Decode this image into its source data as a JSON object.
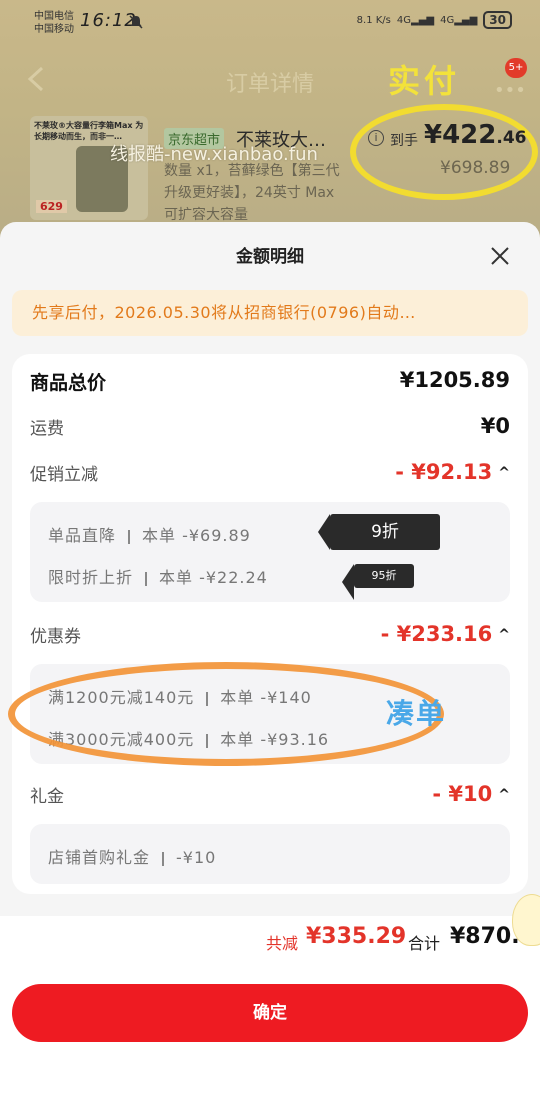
{
  "status_bar": {
    "carrier_1": "中国电信",
    "carrier_2": "中国移动",
    "time": "16:12",
    "speed": "8.1 K/s",
    "network_1": "4G",
    "network_2": "4G",
    "battery": "30"
  },
  "header": {
    "title": "订单详情",
    "annotation_actual_pay": "实付",
    "badge_count": "5+"
  },
  "product": {
    "store_tag": "京东超市",
    "name": "不莱玫大…",
    "desc": "数量 x1，苔藓绿色【第三代升级更好装】，24英寸 Max可扩容大容量",
    "thumb_text": "不莱玫®大容量行李箱Max 为长期移动而生，而非一…",
    "thumb_price": "629",
    "watermark": "线报酷-new.xianbao.fun",
    "pay_label": "到手",
    "pay_amount_int": "¥422",
    "pay_amount_dec": ".46",
    "orig_amount": "¥698.89"
  },
  "sheet": {
    "title": "金额明细",
    "notice": "先享后付，2026.05.30将从招商银行(0796)自动…",
    "total_label": "商品总价",
    "total_value": "¥1205.89",
    "shipping_label": "运费",
    "shipping_value": "¥0",
    "promo_label": "促销立减",
    "promo_value": "- ¥92.13",
    "promo_items": [
      {
        "name": "单品直降",
        "detail": "本单 -¥69.89",
        "tag": "9折"
      },
      {
        "name": "限时折上折",
        "detail": "本单 -¥22.24",
        "tag": "95折"
      }
    ],
    "coupon_label": "优惠券",
    "coupon_value": "- ¥233.16",
    "coupon_items": [
      {
        "name": "满1200元减140元",
        "detail": "本单 -¥140"
      },
      {
        "name": "满3000元减400元",
        "detail": "本单 -¥93.16"
      }
    ],
    "coupon_annotation": "凑单",
    "gift_label": "礼金",
    "gift_value": "- ¥10",
    "gift_items": [
      {
        "name": "店铺首购礼金",
        "detail": "-¥10"
      }
    ]
  },
  "totals": {
    "reduce_label": "共减",
    "reduce_value": "¥335.29",
    "sum_label": "合计",
    "sum_value": "¥870.6"
  },
  "confirm_label": "确定",
  "colors": {
    "accent_red": "#e3342a",
    "button_red": "#ee1b22",
    "notice_orange": "#e27a1b",
    "annotation_yellow": "#f2dc30",
    "annotation_orange": "#f29437"
  }
}
